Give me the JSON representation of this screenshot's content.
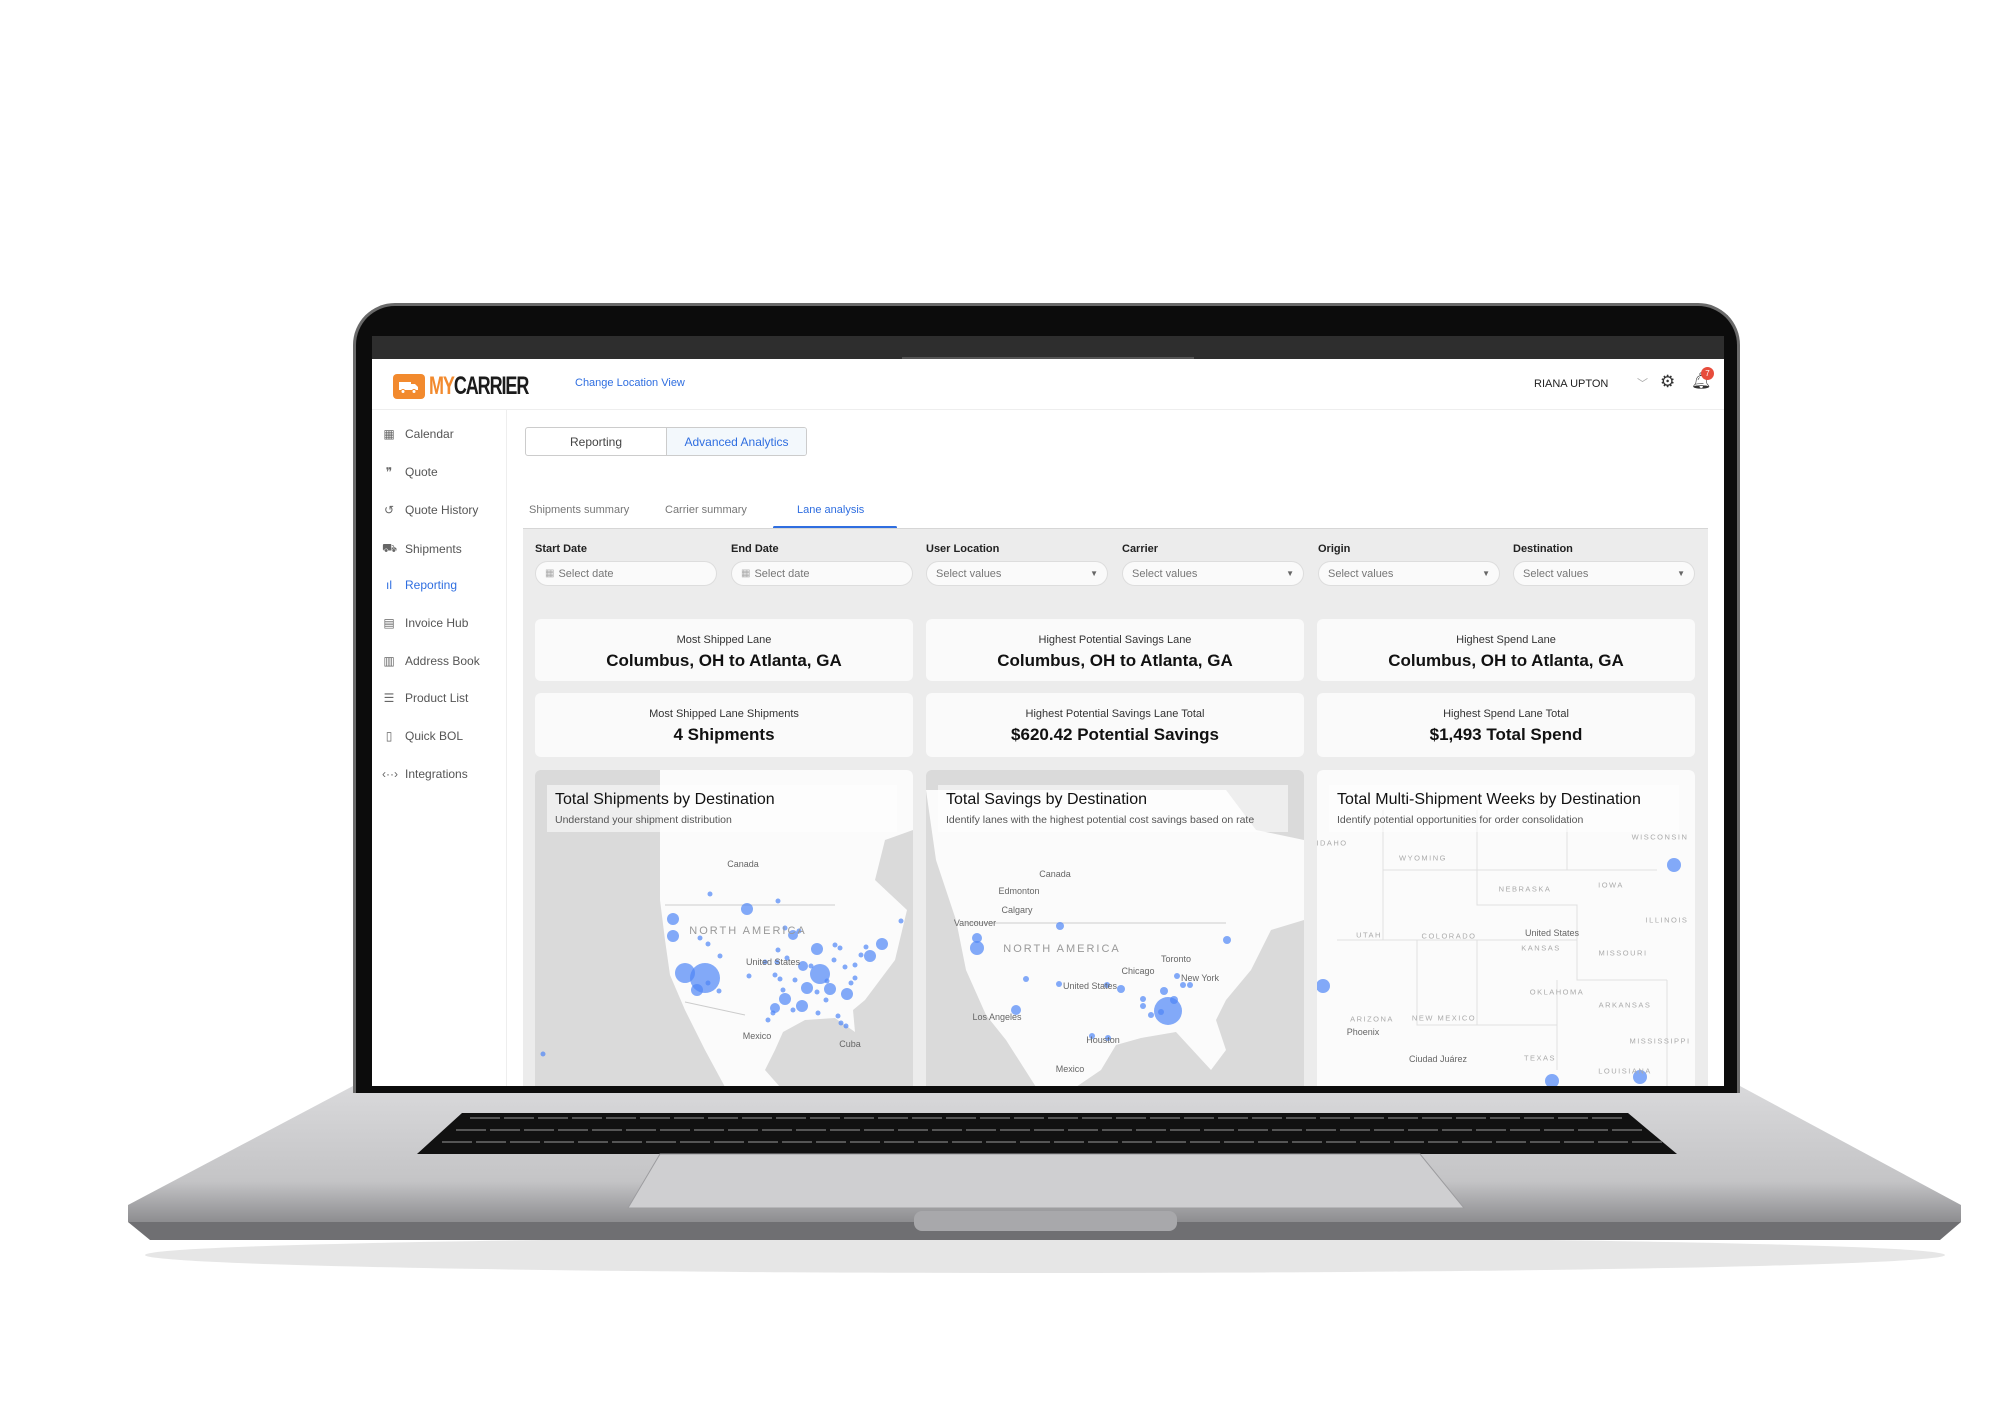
{
  "brand": {
    "logo_my": "MY",
    "logo_carrier": "CARRIER",
    "accent": "#f28a2e",
    "link_color": "#2f6ee0"
  },
  "header": {
    "change_location": "Change Location View",
    "user_name": "RIANA UPTON",
    "notification_count": "7"
  },
  "sidebar": {
    "items": [
      {
        "label": "Calendar",
        "icon": "calendar-icon",
        "glyph": "▦"
      },
      {
        "label": "Quote",
        "icon": "quote-icon",
        "glyph": "❞"
      },
      {
        "label": "Quote History",
        "icon": "history-icon",
        "glyph": "↺"
      },
      {
        "label": "Shipments",
        "icon": "truck-icon",
        "glyph": "⛟"
      },
      {
        "label": "Reporting",
        "icon": "bar-chart-icon",
        "glyph": "ıl",
        "active": true
      },
      {
        "label": "Invoice Hub",
        "icon": "invoice-icon",
        "glyph": "▤"
      },
      {
        "label": "Address Book",
        "icon": "book-icon",
        "glyph": "▥"
      },
      {
        "label": "Product List",
        "icon": "list-icon",
        "glyph": "☰"
      },
      {
        "label": "Quick BOL",
        "icon": "document-icon",
        "glyph": "▯"
      },
      {
        "label": "Integrations",
        "icon": "code-icon",
        "glyph": "‹··›"
      }
    ]
  },
  "view_tabs": [
    {
      "label": "Reporting"
    },
    {
      "label": "Advanced Analytics",
      "active": true
    }
  ],
  "sub_tabs": [
    {
      "label": "Shipments summary"
    },
    {
      "label": "Carrier summary"
    },
    {
      "label": "Lane analysis",
      "active": true
    }
  ],
  "filters": [
    {
      "label": "Start Date",
      "placeholder": "Select date",
      "type": "date"
    },
    {
      "label": "End Date",
      "placeholder": "Select date",
      "type": "date"
    },
    {
      "label": "User Location",
      "placeholder": "Select values",
      "type": "select"
    },
    {
      "label": "Carrier",
      "placeholder": "Select values",
      "type": "select"
    },
    {
      "label": "Origin",
      "placeholder": "Select values",
      "type": "select"
    },
    {
      "label": "Destination",
      "placeholder": "Select values",
      "type": "select"
    }
  ],
  "kpis": [
    {
      "title": "Most Shipped Lane",
      "value": "Columbus, OH to Atlanta, GA"
    },
    {
      "title": "Highest Potential Savings Lane",
      "value": "Columbus, OH to Atlanta, GA"
    },
    {
      "title": "Highest Spend Lane",
      "value": "Columbus, OH to Atlanta, GA"
    },
    {
      "title": "Most Shipped Lane Shipments",
      "value": "4 Shipments"
    },
    {
      "title": "Highest Potential Savings Lane Total",
      "value": "$620.42 Potential Savings"
    },
    {
      "title": "Highest Spend Lane Total",
      "value": "$1,493 Total Spend"
    }
  ],
  "maps": [
    {
      "title": "Total Shipments by Destination",
      "subtitle": "Understand your shipment distribution",
      "labels": [
        "Canada",
        "NORTH AMERICA",
        "United States",
        "Mexico",
        "Cuba"
      ]
    },
    {
      "title": "Total Savings by Destination",
      "subtitle": "Identify lanes with the highest potential cost savings based on rate",
      "labels": [
        "Canada",
        "Edmonton",
        "Calgary",
        "Vancouver",
        "NORTH AMERICA",
        "Toronto",
        "Chicago",
        "New York",
        "United States",
        "Los Angeles",
        "Houston",
        "Mexico"
      ]
    },
    {
      "title": "Total Multi-Shipment Weeks by Destination",
      "subtitle": "Identify potential opportunities for order consolidation",
      "labels": [
        "IDAHO",
        "WYOMING",
        "NEBRASKA",
        "IOWA",
        "WISCONSIN",
        "UTAH",
        "COLORADO",
        "United States",
        "KANSAS",
        "MISSOURI",
        "ILLINOIS",
        "OKLAHOMA",
        "ARKANSAS",
        "ARIZONA",
        "Phoenix",
        "NEW MEXICO",
        "Ciudad Juárez",
        "TEXAS",
        "MISSISSIPPI",
        "LOUISIANA"
      ]
    }
  ],
  "bubble_color": "#4f86f7"
}
